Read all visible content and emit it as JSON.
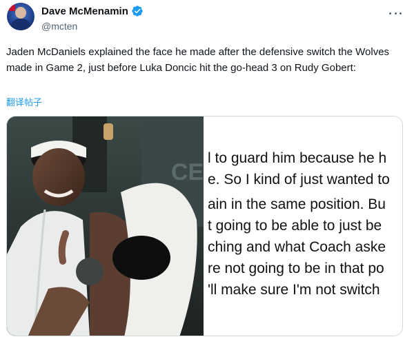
{
  "author": {
    "display_name": "Dave McMenamin",
    "handle": "@mcten",
    "verified": true
  },
  "tweet": {
    "text": "Jaden McDaniels explained the face he made after the defensive switch the Wolves made in Game 2, just before Luka Doncic hit the go-head 3 on Rudy Gobert:",
    "translate_label": "翻译帖子"
  },
  "media": {
    "quote_lines": [
      "l to guard him because he h",
      "e. So I kind of just wanted to",
      "ain in the same position. Bu",
      "t going to be able to just be",
      "ching and what Coach aske",
      "re not going to be in that po",
      "'ll make sure I'm not switch"
    ]
  },
  "icons": {
    "more": "more-options-icon",
    "verified": "verified-badge-icon"
  },
  "colors": {
    "accent": "#1d9bf0",
    "secondary_text": "#536471",
    "primary_text": "#0f1419"
  }
}
